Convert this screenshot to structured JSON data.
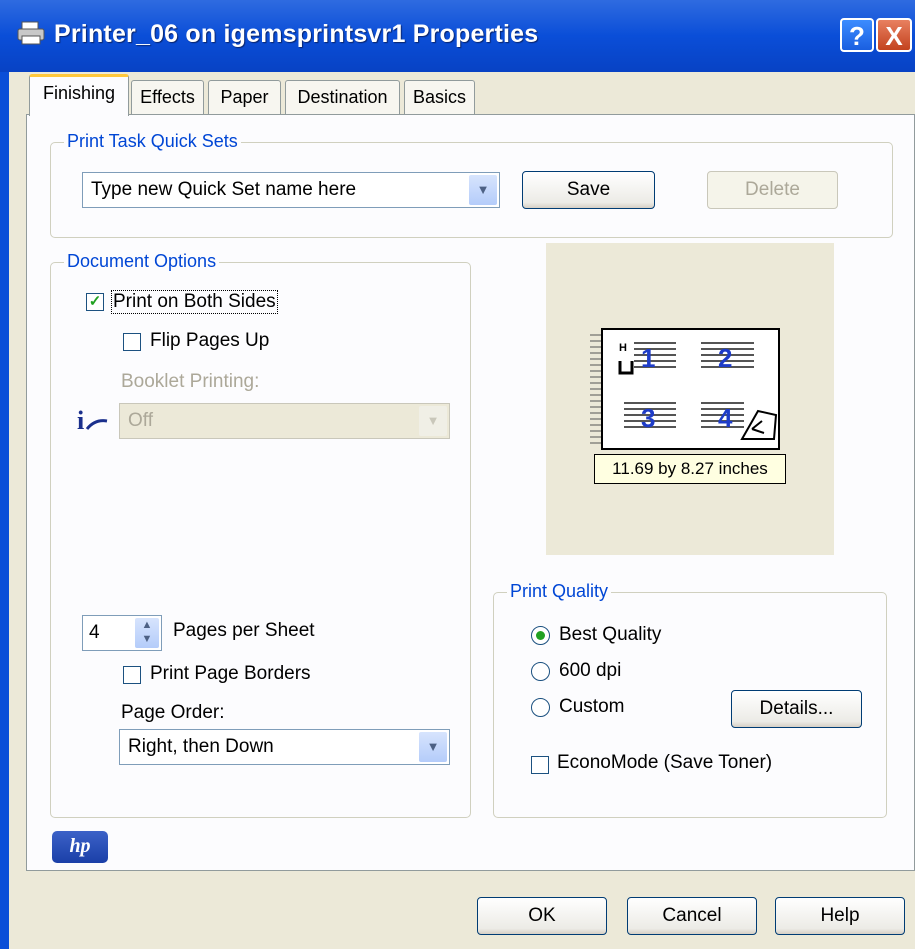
{
  "window": {
    "title": "Printer_06 on igemsprintsvr1 Properties",
    "help_glyph": "?",
    "close_glyph": "X",
    "icon": "printer-icon"
  },
  "tabs": [
    {
      "label": "Finishing",
      "active": true
    },
    {
      "label": "Effects",
      "active": false
    },
    {
      "label": "Paper",
      "active": false
    },
    {
      "label": "Destination",
      "active": false
    },
    {
      "label": "Basics",
      "active": false
    }
  ],
  "quick_sets": {
    "legend": "Print Task Quick Sets",
    "combo_value": "Type new Quick Set name here",
    "save_label": "Save",
    "delete_label": "Delete"
  },
  "document_options": {
    "legend": "Document Options",
    "print_both_sides": {
      "label": "Print on Both Sides",
      "checked": true
    },
    "flip_pages_up": {
      "label": "Flip Pages Up",
      "checked": false
    },
    "booklet_label": "Booklet Printing:",
    "booklet_value": "Off",
    "pages_per_sheet_value": "4",
    "pages_per_sheet_label": "Pages per Sheet",
    "print_page_borders": {
      "label": "Print Page Borders",
      "checked": false
    },
    "page_order_label": "Page Order:",
    "page_order_value": "Right, then Down"
  },
  "preview": {
    "pages": [
      "1",
      "2",
      "3",
      "4"
    ],
    "size_label": "11.69 by 8.27 inches"
  },
  "print_quality": {
    "legend": "Print Quality",
    "options": [
      {
        "label": "Best Quality",
        "selected": true
      },
      {
        "label": "600 dpi",
        "selected": false
      },
      {
        "label": "Custom",
        "selected": false
      }
    ],
    "details_label": "Details...",
    "economode": {
      "label": "EconoMode (Save Toner)",
      "checked": false
    }
  },
  "logo_text": "hp",
  "buttons": {
    "ok": "OK",
    "cancel": "Cancel",
    "help": "Help"
  },
  "colors": {
    "title_bar": "#0A4ED8",
    "dialog_bg": "#ECE9D8",
    "legend_text": "#0046D5",
    "page_number": "#1E3CC8",
    "hp_logo": "#1A3FA8"
  }
}
